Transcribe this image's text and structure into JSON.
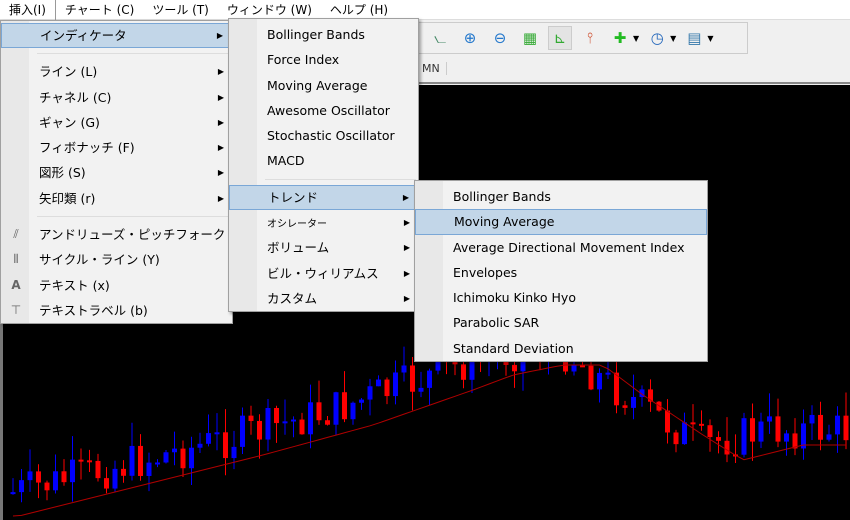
{
  "menubar": [
    "挿入(I)",
    "チャート (C)",
    "ツール (T)",
    "ウィンドウ (W)",
    "ヘルプ (H)"
  ],
  "timeframe": {
    "visible": "MN"
  },
  "toolbar": {
    "icons": [
      "line-chart-icon",
      "zoom-in-icon",
      "zoom-out-icon",
      "tile-windows-icon",
      "auto-scroll-icon",
      "chart-shift-icon",
      "add-indicator-icon",
      "periodicity-clock-icon",
      "templates-icon"
    ]
  },
  "insert_menu": {
    "items": [
      {
        "label": "インディケータ",
        "submenu": true,
        "highlighted": true
      },
      {
        "label": "ライン (L)",
        "submenu": true
      },
      {
        "label": "チャネル (C)",
        "submenu": true
      },
      {
        "label": "ギャン (G)",
        "submenu": true
      },
      {
        "label": "フィボナッチ (F)",
        "submenu": true
      },
      {
        "label": "図形 (S)",
        "submenu": true
      },
      {
        "label": "矢印類 (r)",
        "submenu": true
      },
      {
        "label": "アンドリューズ・ピッチフォーク (A)",
        "icon": "pitchfork-icon"
      },
      {
        "label": "サイクル・ライン (Y)",
        "icon": "cycle-lines-icon"
      },
      {
        "label": "テキスト (x)",
        "icon": "text-icon"
      },
      {
        "label": "テキストラベル (b)",
        "icon": "text-label-icon"
      }
    ]
  },
  "indicator_menu": {
    "items": [
      "Bollinger Bands",
      "Force Index",
      "Moving Average",
      "Awesome Oscillator",
      "Stochastic Oscillator",
      "MACD"
    ],
    "groups": [
      "トレンド",
      "オシレーター",
      "ボリューム",
      "ビル・ウィリアムス",
      "カスタム"
    ]
  },
  "trend_menu": {
    "items": [
      "Bollinger Bands",
      "Moving Average",
      "Average Directional Movement Index",
      "Envelopes",
      "Ichimoku Kinko Hyo",
      "Parabolic SAR",
      "Standard Deviation"
    ],
    "highlighted": "Moving Average"
  },
  "chart": {
    "background": "#000000",
    "bull_color": "#0000ff",
    "bear_color": "#ff0000",
    "ma_color": "#b00000"
  }
}
